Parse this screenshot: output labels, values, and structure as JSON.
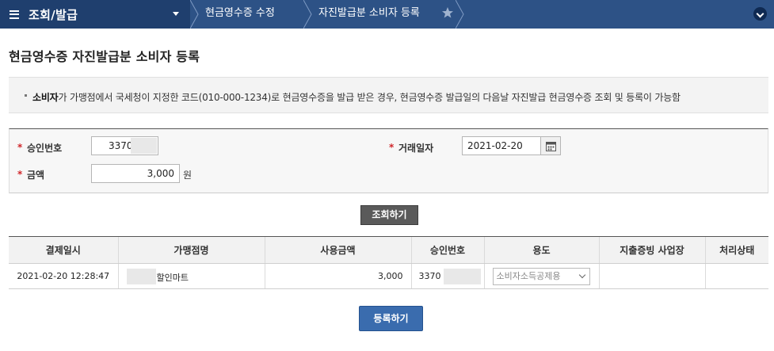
{
  "nav": {
    "menu_title": "조회/발급",
    "crumb_1": "현금영수증 수정",
    "crumb_2": "자진발급분 소비자 등록"
  },
  "page": {
    "title": "현금영수증 자진발급분 소비자 등록"
  },
  "notice": {
    "bold": "소비자",
    "text": "가 가맹점에서 국세청이 지정한 코드(010-000-1234)로 현금영수증을 발급 받은 경우, 현금영수증 발급일의 다음날 자진발급 현금영수증 조회 및 등록이 가능함"
  },
  "form": {
    "approval_label": "승인번호",
    "approval_value": "3370",
    "date_label": "거래일자",
    "date_value": "2021-02-20",
    "amount_label": "금액",
    "amount_value": "3,000",
    "amount_unit": "원",
    "required_mark": "*"
  },
  "buttons": {
    "search": "조회하기",
    "register": "등록하기"
  },
  "table": {
    "headers": [
      "결제일시",
      "가맹점명",
      "사용금액",
      "승인번호",
      "용도",
      "지출증빙 사업장",
      "처리상태"
    ],
    "rows": [
      {
        "datetime": "2021-02-20 12:28:47",
        "merchant": "할인마트",
        "amount": "3,000",
        "approval": "3370",
        "purpose": "소비자소득공제용",
        "business": "",
        "status": ""
      }
    ]
  },
  "colors": {
    "nav_bg": "#2d5286",
    "menu_bg": "#1f3f6e",
    "primary_button": "#3a6cae",
    "required": "#d0262a"
  }
}
